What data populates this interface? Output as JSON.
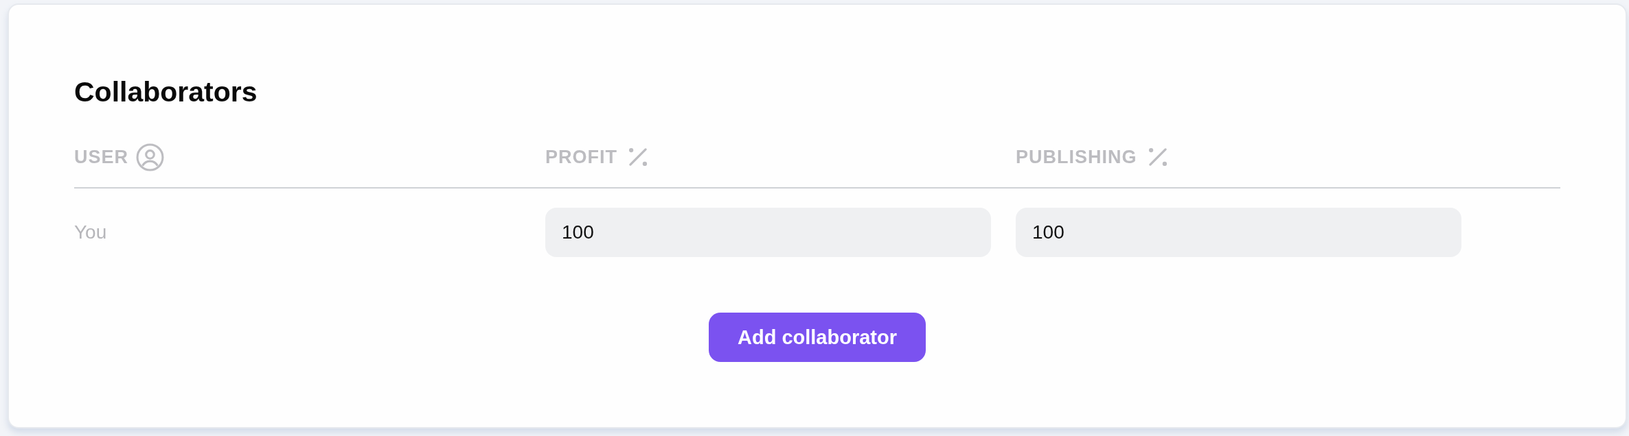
{
  "title": "Collaborators",
  "table": {
    "columns": [
      {
        "label": "USER",
        "kind": "user"
      },
      {
        "label": "PROFIT",
        "kind": "percent"
      },
      {
        "label": "PUBLISHING",
        "kind": "percent"
      }
    ],
    "rows": [
      {
        "user": "You",
        "profit": "100",
        "publishing": "100"
      }
    ]
  },
  "add_button": {
    "label": "Add collaborator"
  }
}
